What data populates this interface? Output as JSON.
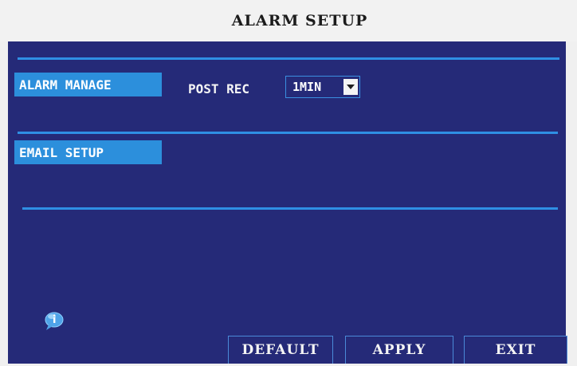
{
  "window": {
    "title": "ALARM SETUP"
  },
  "menu": {
    "items": [
      {
        "label": "ALARM MANAGE",
        "selected": true
      },
      {
        "label": "EMAIL SETUP",
        "selected": false
      }
    ]
  },
  "alarm_manage": {
    "post_rec_label": "POST REC",
    "post_rec_value": "1MIN"
  },
  "buttons": {
    "default_label": "DEFAULT",
    "apply_label": "APPLY",
    "exit_label": "EXIT"
  },
  "icons": {
    "info": "info-icon",
    "dropdown": "chevron-down-icon"
  },
  "colors": {
    "background": "#252a78",
    "accent": "#2c8fdc",
    "title_bar": "#f2f2f2"
  }
}
